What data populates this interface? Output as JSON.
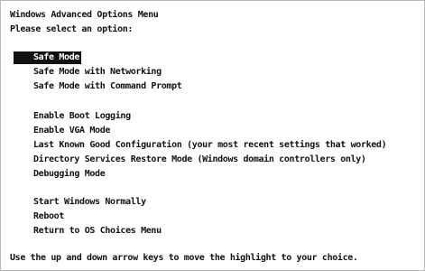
{
  "menu": {
    "title": "Windows Advanced Options Menu",
    "prompt": "Please select an option:",
    "groups": [
      {
        "items": [
          {
            "label": "Safe Mode",
            "selected": true
          },
          {
            "label": "Safe Mode with Networking"
          },
          {
            "label": "Safe Mode with Command Prompt"
          }
        ]
      },
      {
        "items": [
          {
            "label": "Enable Boot Logging"
          },
          {
            "label": "Enable VGA Mode"
          },
          {
            "label": "Last Known Good Configuration (your most recent settings that worked)"
          },
          {
            "label": "Directory Services Restore Mode (Windows domain controllers only)"
          },
          {
            "label": "Debugging Mode"
          }
        ]
      },
      {
        "items": [
          {
            "label": "Start Windows Normally"
          },
          {
            "label": "Reboot"
          },
          {
            "label": "Return to OS Choices Menu"
          }
        ]
      }
    ],
    "footer": "Use the up and down arrow keys to move the highlight to your choice."
  },
  "colors": {
    "background": "#ffffff",
    "text": "#111111",
    "highlight_bg": "#111111",
    "highlight_text": "#ffffff"
  }
}
